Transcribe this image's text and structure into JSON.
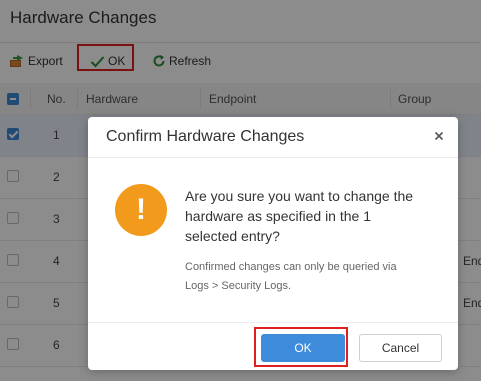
{
  "page": {
    "title": "Hardware Changes"
  },
  "toolbar": {
    "export_label": "Export",
    "ok_label": "OK",
    "refresh_label": "Refresh"
  },
  "table": {
    "headers": {
      "no": "No.",
      "hardware": "Hardware",
      "endpoint": "Endpoint",
      "group": "Group"
    },
    "rows": [
      {
        "no": "1",
        "selected": true,
        "end": ""
      },
      {
        "no": "2",
        "selected": false,
        "end": ""
      },
      {
        "no": "3",
        "selected": false,
        "end": ""
      },
      {
        "no": "4",
        "selected": false,
        "end": "End"
      },
      {
        "no": "5",
        "selected": false,
        "end": "End"
      },
      {
        "no": "6",
        "selected": false,
        "end": ""
      }
    ]
  },
  "dialog": {
    "title": "Confirm Hardware Changes",
    "icon_text": "!",
    "question": "Are you sure you want to change the hardware as specified in the 1 selected entry?",
    "note": "Confirmed changes can only be queried via Logs > Security Logs.",
    "ok_label": "OK",
    "cancel_label": "Cancel"
  },
  "colors": {
    "accent": "#3e8bdc",
    "warning": "#f29a1c",
    "highlight": "#e02020"
  },
  "icons": {
    "export": "export-icon",
    "ok": "checkmark-icon",
    "refresh": "refresh-icon",
    "close": "close-icon",
    "warning": "warning-icon"
  }
}
